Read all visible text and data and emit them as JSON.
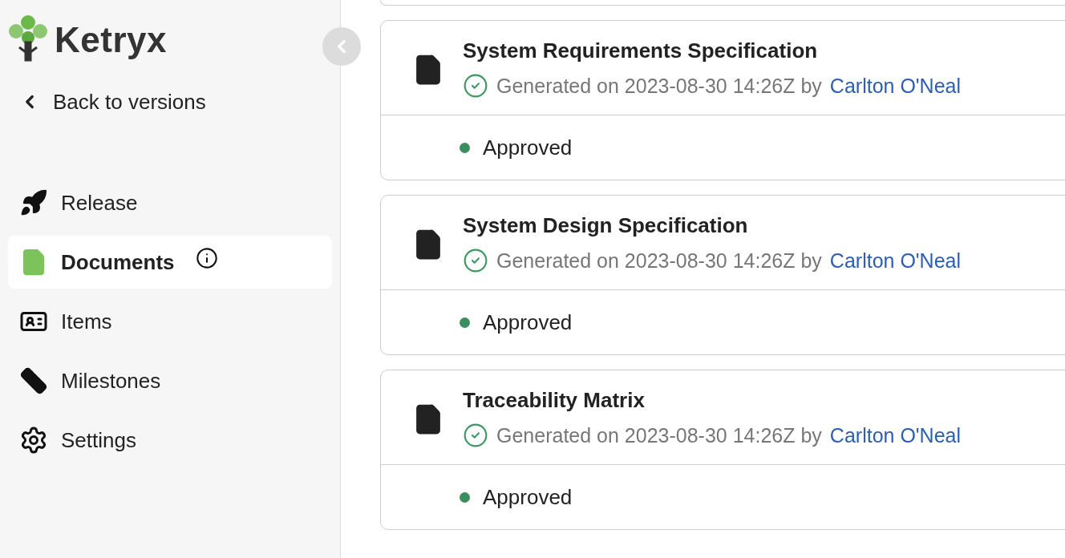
{
  "brand": {
    "name": "Ketryx"
  },
  "back_link": "Back to versions",
  "nav": [
    {
      "label": "Release",
      "kind": "rocket",
      "selected": false,
      "info": false
    },
    {
      "label": "Documents",
      "kind": "file",
      "selected": true,
      "info": true
    },
    {
      "label": "Items",
      "kind": "card",
      "selected": false,
      "info": false
    },
    {
      "label": "Milestones",
      "kind": "ruler",
      "selected": false,
      "info": false
    },
    {
      "label": "Settings",
      "kind": "gear",
      "selected": false,
      "info": false
    }
  ],
  "documents": [
    {
      "title": "System Requirements Specification",
      "generated": "Generated on 2023-08-30 14:26Z by",
      "author": "Carlton O'Neal",
      "status": "Approved"
    },
    {
      "title": "System Design Specification",
      "generated": "Generated on 2023-08-30 14:26Z by",
      "author": "Carlton O'Neal",
      "status": "Approved"
    },
    {
      "title": "Traceability Matrix",
      "generated": "Generated on 2023-08-30 14:26Z by",
      "author": "Carlton O'Neal",
      "status": "Approved"
    }
  ]
}
